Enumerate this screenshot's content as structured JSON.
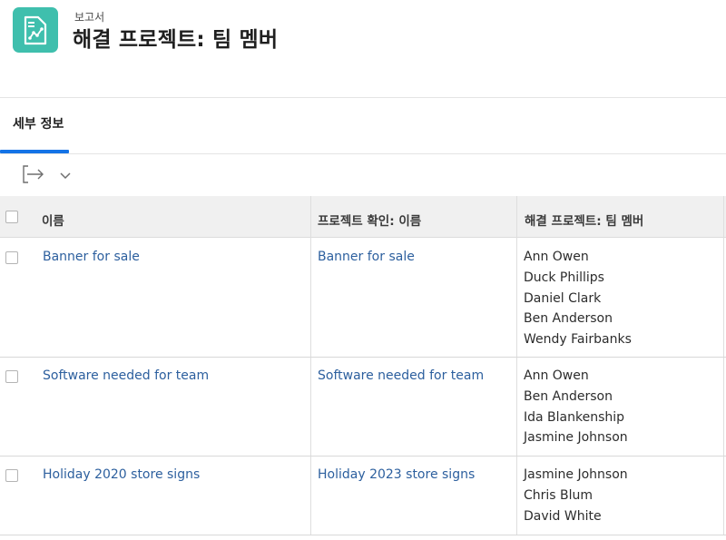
{
  "header": {
    "eyebrow": "보고서",
    "title": "해결 프로젝트: 팀 멤버",
    "icon": "report-chart-icon",
    "icon_color": "#3fbfad"
  },
  "tabs": [
    {
      "label": "세부 정보",
      "active": true
    }
  ],
  "accent_color": "#1473e6",
  "link_color": "#2c5f9e",
  "toolbar": {
    "export_icon": "export-arrow-icon",
    "dropdown_icon": "chevron-down-icon"
  },
  "table": {
    "columns": [
      "이름",
      "프로젝트 확인: 이름",
      "해결 프로젝트: 팀 멤버"
    ],
    "rows": [
      {
        "name": "Banner for sale",
        "project": "Banner for sale",
        "members": [
          "Ann Owen",
          "Duck Phillips",
          "Daniel Clark",
          "Ben Anderson",
          "Wendy Fairbanks"
        ]
      },
      {
        "name": "Software needed for team",
        "project": "Software needed for team",
        "members": [
          "Ann Owen",
          "Ben Anderson",
          "Ida Blankenship",
          "Jasmine Johnson"
        ]
      },
      {
        "name": "Holiday 2020 store signs",
        "project": "Holiday 2023 store signs",
        "members": [
          "Jasmine Johnson",
          "Chris Blum",
          "David White"
        ]
      }
    ]
  }
}
